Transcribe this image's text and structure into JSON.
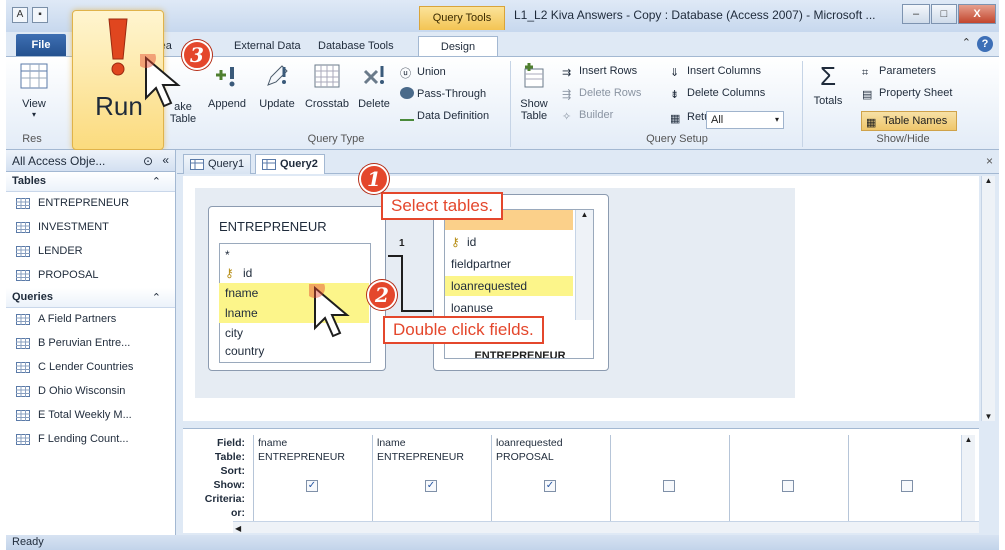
{
  "titlebar": {
    "query_tools": "Query Tools",
    "title": "L1_L2 Kiva Answers - Copy : Database (Access 2007) - Microsoft ...",
    "minimize": "–",
    "maximize": "□",
    "close": "X"
  },
  "ribbon_tabs": {
    "file": "File",
    "create": "rea",
    "external_data": "External Data",
    "database_tools": "Database Tools",
    "design": "Design"
  },
  "ribbon": {
    "view": "View",
    "results_group": "Res",
    "run": "Run",
    "make_table": "ake\nTable",
    "append": "Append",
    "update": "Update",
    "crosstab": "Crosstab",
    "delete": "Delete",
    "union": "Union",
    "pass_through": "Pass-Through",
    "data_definition": "Data Definition",
    "query_type_group": "Query Type",
    "show_table": "Show\nTable",
    "insert_rows": "Insert Rows",
    "delete_rows": "Delete Rows",
    "builder": "Builder",
    "insert_columns": "Insert Columns",
    "delete_columns": "Delete Columns",
    "return_label": "Return:",
    "return_value": "All",
    "query_setup_group": "Query Setup",
    "totals": "Totals",
    "parameters": "Parameters",
    "property_sheet": "Property Sheet",
    "table_names": "Table Names",
    "show_hide_group": "Show/Hide"
  },
  "nav": {
    "header": "All Access Obje...",
    "tables_label": "Tables",
    "tables": [
      "ENTREPRENEUR",
      "INVESTMENT",
      "LENDER",
      "PROPOSAL"
    ],
    "queries_label": "Queries",
    "queries": [
      "A Field Partners",
      "B Peruvian Entre...",
      "C Lender Countries",
      "D Ohio Wisconsin",
      "E Total Weekly M...",
      "F Lending Count..."
    ]
  },
  "doc_tabs": [
    "Query1",
    "Query2"
  ],
  "table1": {
    "title": "ENTREPRENEUR",
    "fields": [
      "*",
      "id",
      "fname",
      "lname",
      "city",
      "country"
    ]
  },
  "table2": {
    "fields": [
      "*",
      "id",
      "fieldpartner",
      "loanrequested",
      "loanuse"
    ],
    "title": "ENTREPRENEUR"
  },
  "join_label": "1",
  "callouts": {
    "step1_num": "1",
    "step1": "Select tables.",
    "step2_num": "2",
    "step2": "Double click fields.",
    "step3_num": "3"
  },
  "grid": {
    "row_labels": [
      "Field:",
      "Table:",
      "Sort:",
      "Show:",
      "Criteria:",
      "or:"
    ],
    "columns": [
      {
        "field": "fname",
        "table": "ENTREPRENEUR",
        "show": true
      },
      {
        "field": "lname",
        "table": "ENTREPRENEUR",
        "show": true
      },
      {
        "field": "loanrequested",
        "table": "PROPOSAL",
        "show": true
      },
      {
        "field": "",
        "table": "",
        "show": false
      },
      {
        "field": "",
        "table": "",
        "show": false
      },
      {
        "field": "",
        "table": "",
        "show": false
      }
    ]
  },
  "status": "Ready",
  "colors": {
    "callout_red": "#e4472c",
    "highlight_yellow": "#fcf58a",
    "run_gold": "#fbdb7e"
  }
}
